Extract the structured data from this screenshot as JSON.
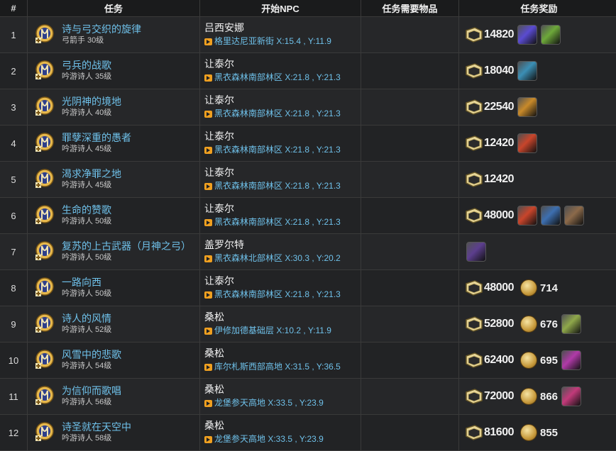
{
  "headers": {
    "num": "#",
    "task": "任务",
    "npc": "开始NPC",
    "items": "任务需要物品",
    "reward": "任务奖励"
  },
  "rows": [
    {
      "num": "1",
      "name": "诗与弓交织的旋律",
      "sub": "弓箭手 30级",
      "npc": "吕西安娜",
      "loc": "格里达尼亚新街 X:15.4 , Y:11.9",
      "exp": "14820",
      "gil": "",
      "items": [
        "#5a4bd1",
        "#6da83a"
      ]
    },
    {
      "num": "2",
      "name": "弓兵的战歌",
      "sub": "吟游诗人 35级",
      "npc": "让泰尔",
      "loc": "黑衣森林南部林区 X:21.8 , Y:21.3",
      "exp": "18040",
      "gil": "",
      "items": [
        "#3b8fb5"
      ]
    },
    {
      "num": "3",
      "name": "光阴神的境地",
      "sub": "吟游诗人 40级",
      "npc": "让泰尔",
      "loc": "黑衣森林南部林区 X:21.8 , Y:21.3",
      "exp": "22540",
      "gil": "",
      "items": [
        "#c88a2a"
      ]
    },
    {
      "num": "4",
      "name": "罪孽深重的愚者",
      "sub": "吟游诗人 45级",
      "npc": "让泰尔",
      "loc": "黑衣森林南部林区 X:21.8 , Y:21.3",
      "exp": "12420",
      "gil": "",
      "items": [
        "#c9452b"
      ]
    },
    {
      "num": "5",
      "name": "渴求净罪之地",
      "sub": "吟游诗人 45级",
      "npc": "让泰尔",
      "loc": "黑衣森林南部林区 X:21.8 , Y:21.3",
      "exp": "12420",
      "gil": "",
      "items": []
    },
    {
      "num": "6",
      "name": "生命的赞歌",
      "sub": "吟游诗人 50级",
      "npc": "让泰尔",
      "loc": "黑衣森林南部林区 X:21.8 , Y:21.3",
      "exp": "48000",
      "gil": "",
      "items": [
        "#c9452b",
        "#3d6fb0",
        "#8c6a4a"
      ]
    },
    {
      "num": "7",
      "name": "复苏的上古武器（月神之弓）",
      "sub": "吟游诗人 50级",
      "npc": "盖罗尔特",
      "loc": "黑衣森林北部林区 X:30.3 , Y:20.2",
      "exp": "",
      "gil": "",
      "items": [
        "#5c3e8e"
      ]
    },
    {
      "num": "8",
      "name": "一路向西",
      "sub": "吟游诗人 50级",
      "npc": "让泰尔",
      "loc": "黑衣森林南部林区 X:21.8 , Y:21.3",
      "exp": "48000",
      "gil": "714",
      "items": []
    },
    {
      "num": "9",
      "name": "诗人的风情",
      "sub": "吟游诗人 52级",
      "npc": "桑松",
      "loc": "伊修加德基础层 X:10.2 , Y:11.9",
      "exp": "52800",
      "gil": "676",
      "items": [
        "#8fa84a"
      ]
    },
    {
      "num": "10",
      "name": "风雪中的悲歌",
      "sub": "吟游诗人 54级",
      "npc": "桑松",
      "loc": "库尔札斯西部高地 X:31.5 , Y:36.5",
      "exp": "62400",
      "gil": "695",
      "items": [
        "#b03aa8"
      ]
    },
    {
      "num": "11",
      "name": "为信仰而歌唱",
      "sub": "吟游诗人 56级",
      "npc": "桑松",
      "loc": "龙堡参天高地 X:33.5 , Y:23.9",
      "exp": "72000",
      "gil": "866",
      "items": [
        "#c23a7a"
      ]
    },
    {
      "num": "12",
      "name": "诗圣就在天空中",
      "sub": "吟游诗人 58级",
      "npc": "桑松",
      "loc": "龙堡参天高地 X:33.5 , Y:23.9",
      "exp": "81600",
      "gil": "855",
      "items": []
    }
  ]
}
